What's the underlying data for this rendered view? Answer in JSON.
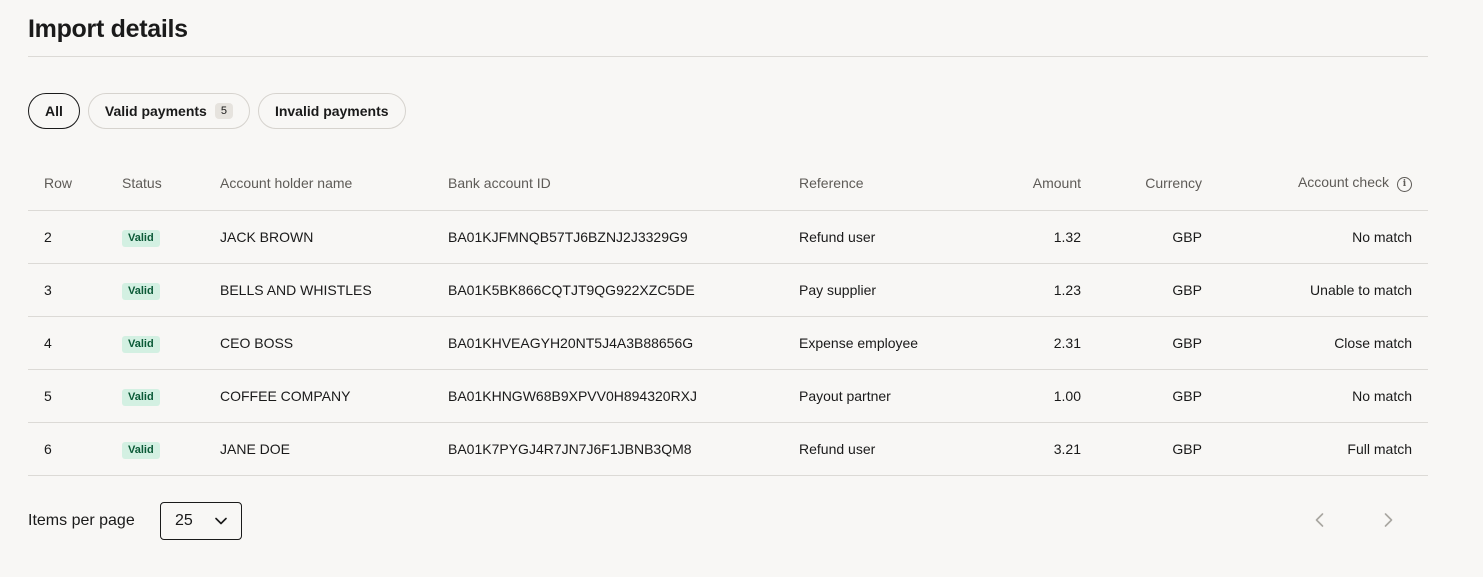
{
  "page": {
    "title": "Import details"
  },
  "tabs": [
    {
      "label": "All",
      "active": true
    },
    {
      "label": "Valid payments",
      "count": "5"
    },
    {
      "label": "Invalid payments"
    }
  ],
  "table": {
    "headers": {
      "row": "Row",
      "status": "Status",
      "name": "Account holder name",
      "bank": "Bank account ID",
      "reference": "Reference",
      "amount": "Amount",
      "currency": "Currency",
      "check": "Account check"
    },
    "rows": [
      {
        "row": "2",
        "status": "Valid",
        "name": "JACK BROWN",
        "bank": "BA01KJFMNQB57TJ6BZNJ2J3329G9",
        "reference": "Refund user",
        "amount": "1.32",
        "currency": "GBP",
        "check": "No match"
      },
      {
        "row": "3",
        "status": "Valid",
        "name": "BELLS AND WHISTLES",
        "bank": "BA01K5BK866CQTJT9QG922XZC5DE",
        "reference": "Pay supplier",
        "amount": "1.23",
        "currency": "GBP",
        "check": "Unable to match"
      },
      {
        "row": "4",
        "status": "Valid",
        "name": "CEO BOSS",
        "bank": "BA01KHVEAGYH20NT5J4A3B88656G",
        "reference": "Expense employee",
        "amount": "2.31",
        "currency": "GBP",
        "check": "Close match"
      },
      {
        "row": "5",
        "status": "Valid",
        "name": "COFFEE COMPANY",
        "bank": "BA01KHNGW68B9XPVV0H894320RXJ",
        "reference": "Payout partner",
        "amount": "1.00",
        "currency": "GBP",
        "check": "No match"
      },
      {
        "row": "6",
        "status": "Valid",
        "name": "JANE DOE",
        "bank": "BA01K7PYGJ4R7JN7J6F1JBNB3QM8",
        "reference": "Refund user",
        "amount": "3.21",
        "currency": "GBP",
        "check": "Full match"
      }
    ]
  },
  "footer": {
    "items_per_page_label": "Items per page",
    "items_per_page_value": "25"
  },
  "icons": {
    "info": "info-icon",
    "select_chevron": "chevron-down-icon",
    "prev": "chevron-left-icon",
    "next": "chevron-right-icon"
  },
  "colors": {
    "background": "#f8f7f5",
    "badge_bg": "#d3f0e2",
    "badge_text": "#0b5a37",
    "border": "#dcdad6"
  }
}
